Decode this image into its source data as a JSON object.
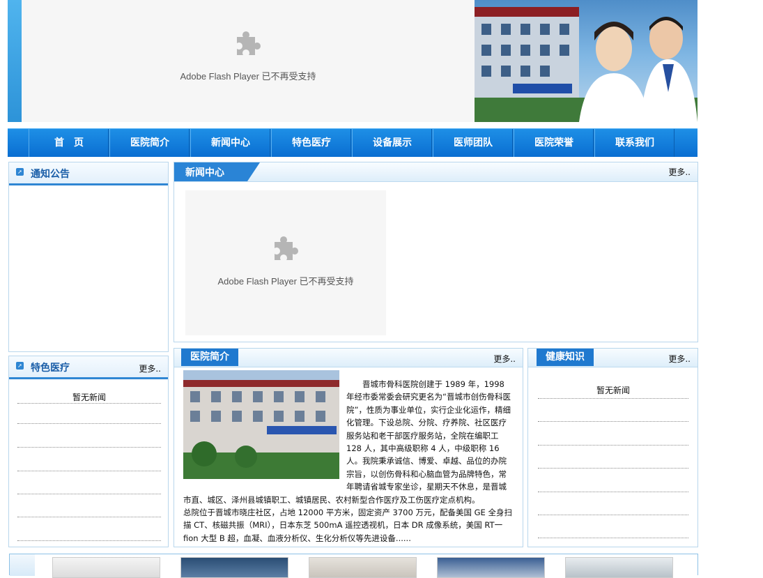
{
  "header": {
    "flash_notice": "Adobe Flash Player 已不再受支持"
  },
  "nav": {
    "items": [
      "首　页",
      "医院简介",
      "新闻中心",
      "特色医疗",
      "设备展示",
      "医师团队",
      "医院荣誉",
      "联系我们"
    ]
  },
  "notice_panel": {
    "title": "通知公告"
  },
  "special_panel": {
    "title": "特色医疗",
    "more": "更多..",
    "empty": "暂无新闻"
  },
  "news_panel": {
    "title": "新闻中心",
    "more": "更多..",
    "flash_notice": "Adobe Flash Player 已不再受支持"
  },
  "intro_panel": {
    "title": "医院简介",
    "more": "更多..",
    "text": "　　晋城市骨科医院创建于 1989 年，1998 年经市委常委会研究更名为“晋城市创伤骨科医院”，性质为事业单位，实行企业化运作，精细化管理。下设总院、分院、疗养院、社区医疗服务站和老干部医疗服务站，全院在编职工 128 人，其中高级职称 4 人，中级职称 16 人。我院秉承诚信、博爱、卓越、品位的办院宗旨，以创伤骨科和心脑血管为品牌特色，常年聘请省城专家坐诊，星期天不休息，是晋城市直、城区、泽州县城镇职工、城镇居民、农村新型合作医疗及工伤医疗定点机构。",
    "text2": "总院位于晋城市晓庄社区，占地 12000 平方米，固定资产 3700 万元，配备美国 GE 全身扫描 CT、核磁共振（MRI），日本东芝 500mA 遥控透视机，日本 DR 成像系统，美国 RT一fion 大型 B 超，血凝、血液分析仪、生化分析仪等先进设备......"
  },
  "health_panel": {
    "title": "健康知识",
    "more": "更多..",
    "empty": "暂无新闻"
  },
  "colors": {
    "nav_blue": "#0a6ed1",
    "accent": "#1f79cf",
    "border": "#b8d6ec"
  }
}
